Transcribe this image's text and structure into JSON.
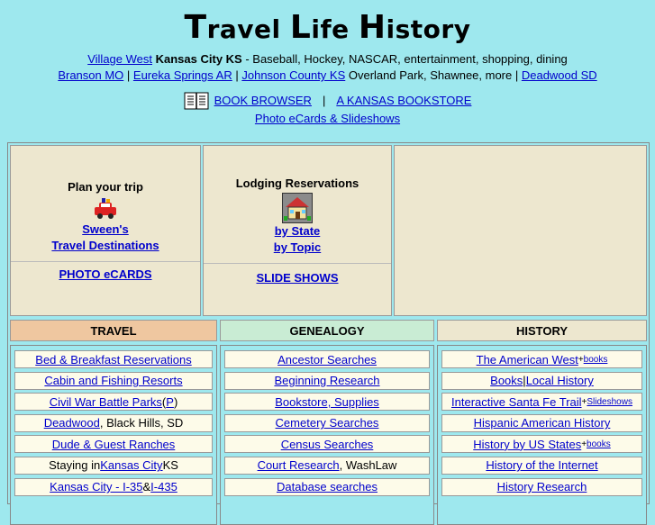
{
  "header": {
    "title_parts": [
      {
        "cap": "T",
        "rest": "ravel "
      },
      {
        "cap": "L",
        "rest": "ife "
      },
      {
        "cap": "H",
        "rest": "istory"
      }
    ]
  },
  "line1": {
    "village_west": "Village West",
    "kansas_city": "Kansas City KS",
    "desc": " - Baseball, Hockey, NASCAR, entertainment, shopping, dining"
  },
  "line2": {
    "branson": "Branson MO",
    "sep": " | ",
    "eureka": "Eureka Springs AR",
    "johnson": "Johnson County KS",
    "johnson_desc": " Overland Park, Shawnee, more | ",
    "deadwood": "Deadwood SD"
  },
  "books": {
    "icon": "open-book-icon",
    "browser": "BOOK BROWSER",
    "sep": "|",
    "bookstore": "A KANSAS BOOKSTORE",
    "ecards": "Photo eCards & Slideshows"
  },
  "panel1": {
    "heading": "Plan your trip",
    "icon": "car-travel-icon",
    "link1": "Sween's",
    "link2": "Travel Destinations",
    "ecards": "PHOTO eCARDS"
  },
  "panel2": {
    "heading": "Lodging Reservations",
    "icon": "house-icon",
    "by_state": "by State",
    "by_topic": "by Topic",
    "slides": "SLIDE SHOWS"
  },
  "headers": [
    "TRAVEL",
    "GENEALOGY",
    "HISTORY"
  ],
  "travel": [
    {
      "parts": [
        {
          "t": "Bed & Breakfast Reservations",
          "link": true
        }
      ]
    },
    {
      "parts": [
        {
          "t": "Cabin and Fishing Resorts",
          "link": true
        }
      ]
    },
    {
      "parts": [
        {
          "t": "Civil War Battle Parks",
          "link": true
        },
        {
          "t": " (",
          "link": false
        },
        {
          "t": "P",
          "link": true
        },
        {
          "t": ")",
          "link": false
        }
      ]
    },
    {
      "parts": [
        {
          "t": "Deadwood",
          "link": true
        },
        {
          "t": ", Black Hills, SD",
          "link": false
        }
      ]
    },
    {
      "parts": [
        {
          "t": "Dude & Guest Ranches",
          "link": true
        }
      ]
    },
    {
      "parts": [
        {
          "t": "Staying in ",
          "link": false
        },
        {
          "t": "Kansas City",
          "link": true
        },
        {
          "t": " KS",
          "link": false
        }
      ]
    },
    {
      "parts": [
        {
          "t": "Kansas City - I-35",
          "link": true
        },
        {
          "t": " & ",
          "link": false
        },
        {
          "t": "I-435",
          "link": true
        }
      ]
    }
  ],
  "genealogy": [
    {
      "parts": [
        {
          "t": "Ancestor Searches",
          "link": true
        }
      ]
    },
    {
      "parts": [
        {
          "t": "Beginning Research",
          "link": true
        }
      ]
    },
    {
      "parts": [
        {
          "t": "Bookstore, Supplies",
          "link": true
        }
      ]
    },
    {
      "parts": [
        {
          "t": "Cemetery Searches",
          "link": true
        }
      ]
    },
    {
      "parts": [
        {
          "t": "Census Searches",
          "link": true
        }
      ]
    },
    {
      "parts": [
        {
          "t": "Court Research",
          "link": true
        },
        {
          "t": ", WashLaw",
          "link": false
        }
      ]
    },
    {
      "parts": [
        {
          "t": "Database searches",
          "link": true
        }
      ]
    }
  ],
  "history": [
    {
      "parts": [
        {
          "t": "The American West",
          "link": true
        },
        {
          "t": " + ",
          "link": false,
          "small": true
        },
        {
          "t": "books",
          "link": true,
          "small": true
        }
      ]
    },
    {
      "parts": [
        {
          "t": "Books",
          "link": true
        },
        {
          "t": " | ",
          "link": false
        },
        {
          "t": "Local History",
          "link": true
        }
      ]
    },
    {
      "parts": [
        {
          "t": "Interactive Santa Fe Trail",
          "link": true
        },
        {
          "t": " + ",
          "link": false,
          "small": true
        },
        {
          "t": "Slideshows",
          "link": true,
          "small": true
        }
      ]
    },
    {
      "parts": [
        {
          "t": "Hispanic American History",
          "link": true
        }
      ]
    },
    {
      "parts": [
        {
          "t": "History by US States",
          "link": true
        },
        {
          "t": " + ",
          "link": false,
          "small": true
        },
        {
          "t": "books",
          "link": true,
          "small": true
        }
      ]
    },
    {
      "parts": [
        {
          "t": "History of the Internet",
          "link": true
        }
      ]
    },
    {
      "parts": [
        {
          "t": "History Research",
          "link": true
        }
      ]
    }
  ],
  "colors": {
    "background": "#9ee8ee",
    "panel": "#ede7cf",
    "travel_header": "#efc7a0",
    "genealogy_header": "#c9ecd4",
    "link": "#0000cc"
  }
}
